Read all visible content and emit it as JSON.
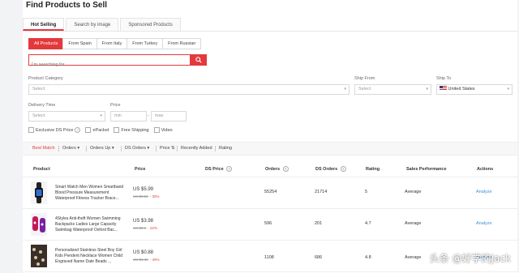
{
  "page": {
    "title": "Find Products to Sell"
  },
  "tabs": [
    {
      "label": "Hot Selling"
    },
    {
      "label": "Search by image"
    },
    {
      "label": "Sponsored Products"
    }
  ],
  "origins": [
    {
      "label": "All Products"
    },
    {
      "label": "From Spain"
    },
    {
      "label": "From Italy"
    },
    {
      "label": "From Turkey"
    },
    {
      "label": "From Russian"
    }
  ],
  "search": {
    "placeholder": "I'm searching for..."
  },
  "filters": {
    "product_category": {
      "label": "Product Category",
      "value": "Select"
    },
    "ship_from": {
      "label": "Ship From",
      "value": "Select"
    },
    "ship_to": {
      "label": "Ship To",
      "value": "United States"
    },
    "delivery_time": {
      "label": "Delivery Time",
      "value": "Select"
    },
    "price": {
      "label": "Price",
      "min_placeholder": "min",
      "max_placeholder": "max",
      "separator": "-"
    }
  },
  "checkboxes": [
    {
      "label": "Exclusive DS Price"
    },
    {
      "label": "ePacket"
    },
    {
      "label": "Free Shipping"
    },
    {
      "label": "Video"
    }
  ],
  "sort": [
    {
      "label": "Best Match"
    },
    {
      "label": "Orders ▾"
    },
    {
      "label": "Orders Up ▾"
    },
    {
      "label": "DS Orders ▾"
    },
    {
      "label": "Price ⇅"
    },
    {
      "label": "Recently Added"
    },
    {
      "label": "Rating"
    }
  ],
  "table": {
    "headers": [
      "Product",
      "Price",
      "DS Price",
      "Orders",
      "DS Orders",
      "Rating",
      "Sales Performance",
      "Actions"
    ],
    "rows": [
      {
        "name": "Smart Watch Men Women Smartband Blood Pressure Measurement Waterproof Fitness Tracker Brace...",
        "price": "US $5.99",
        "orig_price": "US $8.56",
        "discount": "- 30%",
        "orders": "55254",
        "ds_orders": "21714",
        "rating": "5",
        "performance": "Average",
        "action": "Analyze"
      },
      {
        "name": "4Styles Anti-theft Women Swimming Backpacks Ladies Large Capacity Swimbag Waterproof Oxford Bac...",
        "price": "US $3.98",
        "orig_price": "US $5.1",
        "discount": "- 22%",
        "orders": "596",
        "ds_orders": "201",
        "rating": "4.7",
        "performance": "Average",
        "action": "Analyze"
      },
      {
        "name": "Personalized Stainless Steel Boy Girl Kids Pendent Necklace Women Child Engraved Name Date Beads ...",
        "price": "US $0.88",
        "orig_price": "US $1.46",
        "discount": "- 40%",
        "orders": "1108",
        "ds_orders": "686",
        "rating": "4.8",
        "performance": "Average",
        "action": "Analyze"
      }
    ]
  },
  "watermark": "头条 @好学的Jack",
  "colors": {
    "accent": "#e4393c",
    "link": "#3a8fd9"
  },
  "icons": {
    "search": "search-icon",
    "flag": "us-flag-icon",
    "help": "question-icon"
  }
}
